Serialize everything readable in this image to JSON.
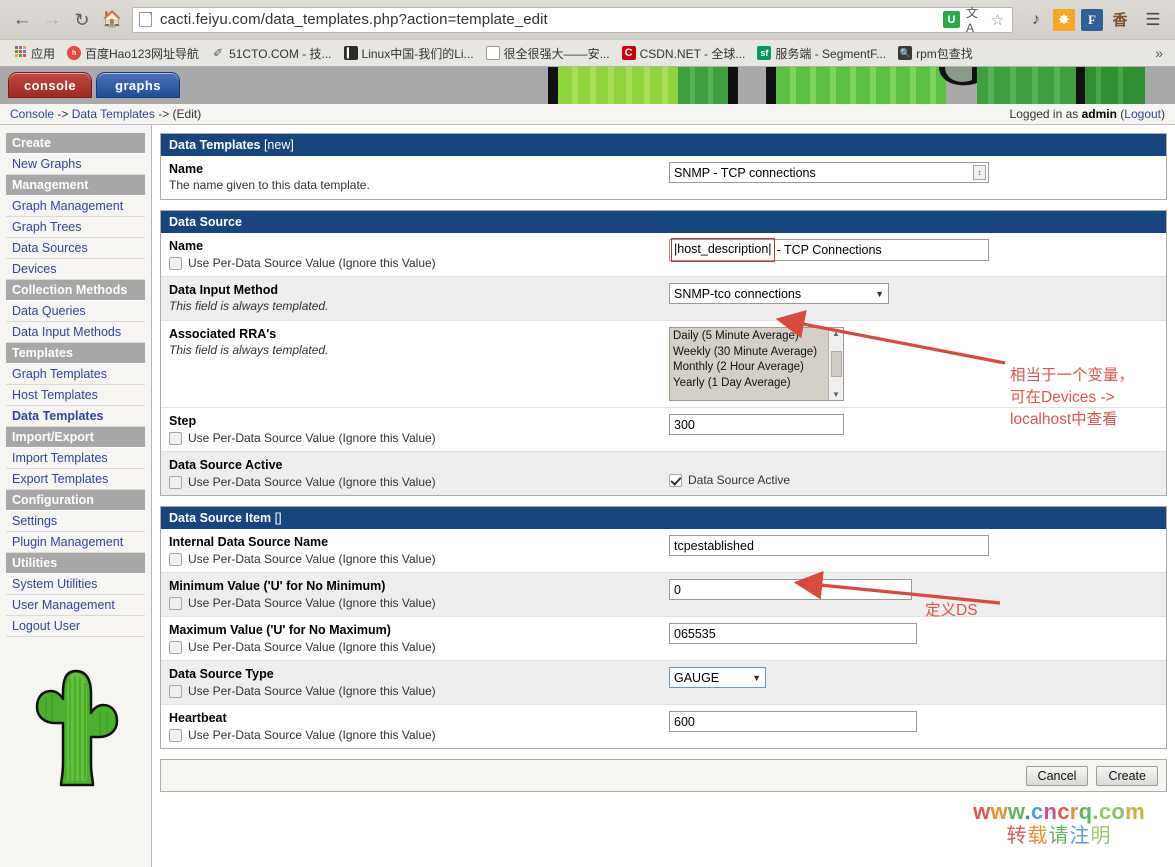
{
  "browser": {
    "url": "cacti.feiyu.com/data_templates.php?action=template_edit",
    "nav": {
      "back": "←",
      "forward": "→",
      "reload": "C",
      "home": "⌂"
    },
    "omnibox_icons": [
      {
        "name": "shield-icon",
        "glyph": "U"
      },
      {
        "name": "translate-icon",
        "glyph": "文A"
      },
      {
        "name": "bookmark-star-icon",
        "glyph": "☆"
      }
    ],
    "extensions": [
      {
        "name": "music-extension-icon",
        "glyph": "♪"
      },
      {
        "name": "star-extension-icon",
        "glyph": "✸"
      },
      {
        "name": "f-extension-icon",
        "glyph": "F"
      },
      {
        "name": "chinese-extension-icon",
        "glyph": "香"
      }
    ],
    "menu_glyph": "☰",
    "bookmarks": [
      {
        "name": "apps",
        "label": "应用",
        "icon": "apps-grid-icon"
      },
      {
        "name": "hao123",
        "label": "百度Hao123网址导航",
        "icon": "hao-icon"
      },
      {
        "name": "51cto",
        "label": "51CTO.COM - 技...",
        "icon": "pen-icon"
      },
      {
        "name": "linux-china",
        "label": "Linux中国-我们的Li...",
        "icon": "book-icon"
      },
      {
        "name": "very-strong",
        "label": "很全很强大——安...",
        "icon": "page-icon"
      },
      {
        "name": "csdn",
        "label": "CSDN.NET - 全球...",
        "icon": "csdn-icon"
      },
      {
        "name": "segmentfault",
        "label": "服务端 - SegmentF...",
        "icon": "sf-icon"
      },
      {
        "name": "rpm-search",
        "label": "rpm包查找",
        "icon": "magnifier-icon"
      }
    ],
    "bookmarks_overflow": "»"
  },
  "cacti": {
    "tabs": [
      {
        "name": "console",
        "label": "console"
      },
      {
        "name": "graphs",
        "label": "graphs"
      }
    ],
    "breadcrumb": {
      "part1": "Console",
      "sep1": " -> ",
      "part2": "Data Templates",
      "sep2": " -> ",
      "part3": "(Edit)"
    },
    "login": {
      "prefix": "Logged in as ",
      "user": "admin",
      "open_paren": " (",
      "logout": "Logout",
      "close_paren": ")"
    },
    "sidebar": [
      {
        "type": "header",
        "label": "Create"
      },
      {
        "type": "item",
        "label": "New Graphs",
        "current": false
      },
      {
        "type": "header",
        "label": "Management"
      },
      {
        "type": "item",
        "label": "Graph Management",
        "current": false
      },
      {
        "type": "item",
        "label": "Graph Trees",
        "current": false
      },
      {
        "type": "item",
        "label": "Data Sources",
        "current": false
      },
      {
        "type": "item",
        "label": "Devices",
        "current": false
      },
      {
        "type": "header",
        "label": "Collection Methods"
      },
      {
        "type": "item",
        "label": "Data Queries",
        "current": false
      },
      {
        "type": "item",
        "label": "Data Input Methods",
        "current": false
      },
      {
        "type": "header",
        "label": "Templates"
      },
      {
        "type": "item",
        "label": "Graph Templates",
        "current": false
      },
      {
        "type": "item",
        "label": "Host Templates",
        "current": false
      },
      {
        "type": "item",
        "label": "Data Templates",
        "current": true
      },
      {
        "type": "header",
        "label": "Import/Export"
      },
      {
        "type": "item",
        "label": "Import Templates",
        "current": false
      },
      {
        "type": "item",
        "label": "Export Templates",
        "current": false
      },
      {
        "type": "header",
        "label": "Configuration"
      },
      {
        "type": "item",
        "label": "Settings",
        "current": false
      },
      {
        "type": "item",
        "label": "Plugin Management",
        "current": false
      },
      {
        "type": "header",
        "label": "Utilities"
      },
      {
        "type": "item",
        "label": "System Utilities",
        "current": false
      },
      {
        "type": "item",
        "label": "User Management",
        "current": false
      },
      {
        "type": "item",
        "label": "Logout User",
        "current": false
      }
    ]
  },
  "panels": {
    "data_templates": {
      "title": "Data Templates",
      "title_sub": "[new]",
      "name_label": "Name",
      "name_desc": "The name given to this data template.",
      "name_value": "SNMP - TCP connections",
      "spinner_glyph": "↕"
    },
    "data_source": {
      "title": "Data Source",
      "per_ds_label": "Use Per-Data Source Value (Ignore this Value)",
      "name_label": "Name",
      "name_var": "|host_description|",
      "name_rest": "- TCP Connections",
      "input_method_label": "Data Input Method",
      "input_method_desc": "This field is always templated.",
      "input_method_value": "SNMP-tco connections",
      "rra_label": "Associated RRA's",
      "rra_desc": "This field is always templated.",
      "rra_options": [
        "Daily (5 Minute Average)",
        "Weekly (30 Minute Average)",
        "Monthly (2 Hour Average)",
        "Yearly (1 Day Average)"
      ],
      "step_label": "Step",
      "step_value": "300",
      "active_label": "Data Source Active",
      "active_checkbox_label": "Data Source Active"
    },
    "data_source_item": {
      "title": "Data Source Item",
      "title_sub": "[]",
      "per_ds_label": "Use Per-Data Source Value (Ignore this Value)",
      "internal_name_label": "Internal Data Source Name",
      "internal_name_value": "tcpestablished",
      "min_label": "Minimum Value ('U' for No Minimum)",
      "min_value": "0",
      "max_label": "Maximum Value ('U' for No Maximum)",
      "max_value": "065535",
      "type_label": "Data Source Type",
      "type_value": "GAUGE",
      "heartbeat_label": "Heartbeat",
      "heartbeat_value": "600"
    }
  },
  "actions": {
    "cancel": "Cancel",
    "create": "Create"
  },
  "annotations": {
    "var_note": "相当于一个变量，\n可在Devices ->\nlocalhost中查看",
    "ds_note": "定义DS",
    "color": "#e0554b"
  },
  "watermark": {
    "url": "www.cncrq.com",
    "subtitle": "转载请注明"
  }
}
